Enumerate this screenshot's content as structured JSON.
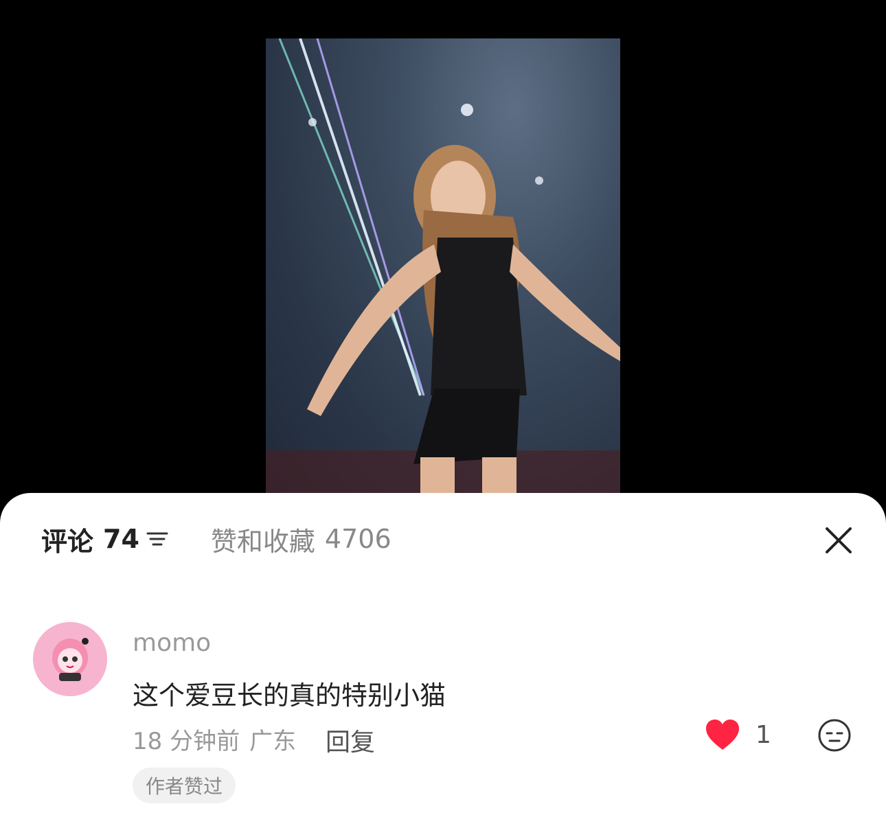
{
  "comments_tab": {
    "label": "评论",
    "count": "74"
  },
  "likes_tab": {
    "label": "赞和收藏",
    "count": "4706"
  },
  "comment": {
    "username": "momo",
    "text": "这个爱豆长的真的特别小猫",
    "time": "18 分钟前",
    "location": "广东",
    "reply_label": "回复",
    "like_count": "1",
    "author_liked_label": "作者赞过"
  },
  "colors": {
    "heart": "#ff2442",
    "sheet_bg": "#ffffff",
    "avatar_bg": "#f7b4cf"
  },
  "icons": [
    "sort-icon",
    "close-icon",
    "heart-icon",
    "emoji-icon"
  ]
}
